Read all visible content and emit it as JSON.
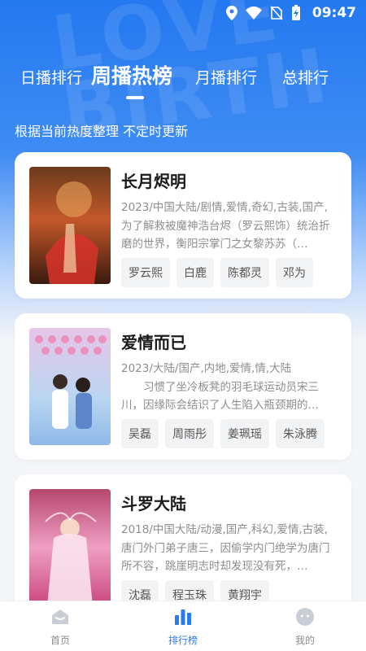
{
  "statusbar": {
    "time": "09:47",
    "icons": [
      "location-icon",
      "wifi-icon",
      "no-sim-icon",
      "battery-charging-icon"
    ]
  },
  "tabs": [
    {
      "label": "日播排行",
      "active": false
    },
    {
      "label": "周播热榜",
      "active": true
    },
    {
      "label": "月播排行",
      "active": false
    },
    {
      "label": "总排行",
      "active": false
    }
  ],
  "subtitle": "根据当前热度整理 不定时更新",
  "cards": [
    {
      "title": "长月烬明",
      "meta": "2023/中国大陆/剧情,爱情,奇幻,古装,国产,",
      "desc": "为了解救被魔神浩台烬（罗云熙饰）统治折磨的世界，衡阳宗掌门之女黎苏苏（…",
      "tags": [
        "罗云熙",
        "白鹿",
        "陈都灵",
        "邓为"
      ]
    },
    {
      "title": "爱情而已",
      "meta": "2023/大陆/国产,内地,爱情,情,大陆",
      "desc": "　　习惯了坐冷板凳的羽毛球运动员宋三川，因缘际会结识了人生陷入瓶颈期的…",
      "tags": [
        "吴磊",
        "周雨彤",
        "姜珮瑶",
        "朱泳腾"
      ]
    },
    {
      "title": "斗罗大陆",
      "meta": "2018/中国大陆/动漫,国产,科幻,爱情,古装,",
      "desc": "唐门外门弟子唐三，因偷学内门绝学为唐门所不容，跳崖明志时却发现没有死，…",
      "tags": [
        "沈磊",
        "程玉珠",
        "黄翔宇"
      ]
    }
  ],
  "nav": [
    {
      "label": "首页",
      "icon": "home-icon",
      "active": false
    },
    {
      "label": "排行榜",
      "icon": "bar-chart-icon",
      "active": true
    },
    {
      "label": "我的",
      "icon": "profile-face-icon",
      "active": false
    }
  ],
  "colors": {
    "accent": "#2a7bf0",
    "hero_top": "#2478f0",
    "background": "#f3f5f9"
  }
}
